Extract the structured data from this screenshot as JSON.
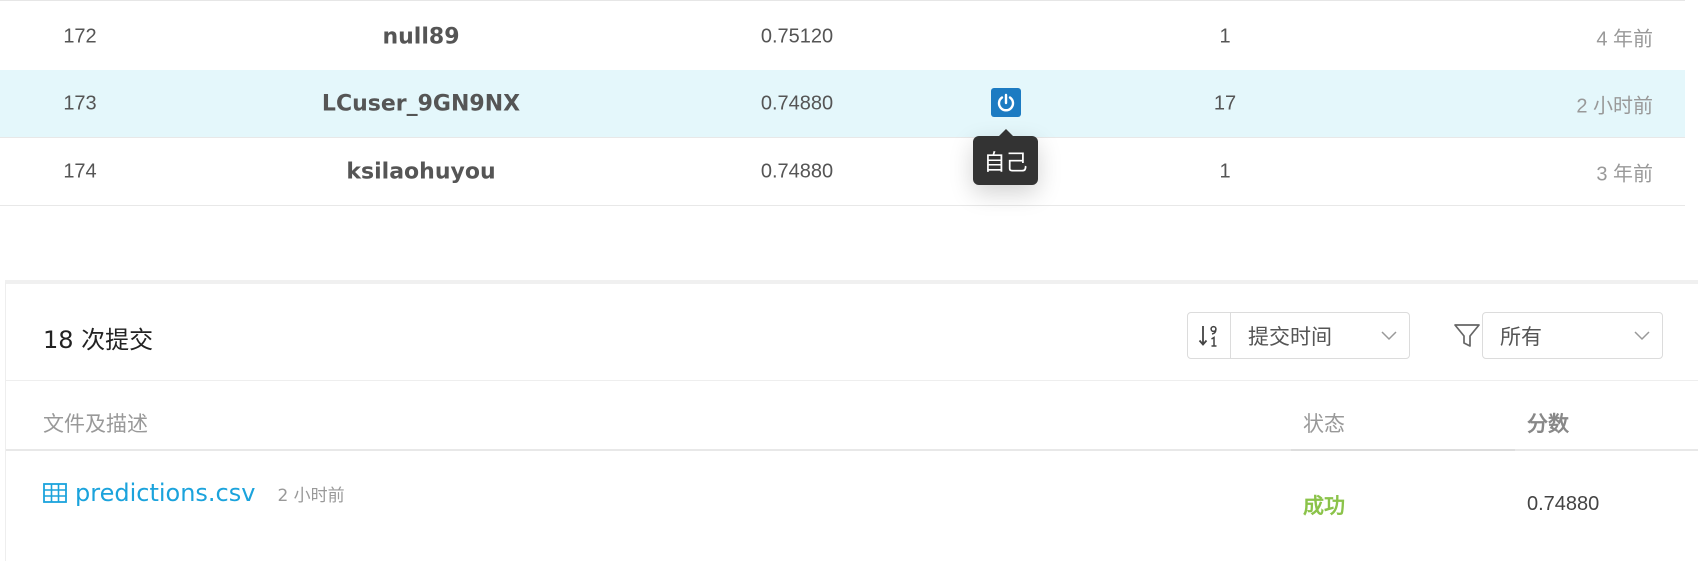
{
  "leaderboard": {
    "rows": [
      {
        "rank": "172",
        "name": "null89",
        "score": "0.75120",
        "entries": "1",
        "time": "4 年前",
        "is_self": false
      },
      {
        "rank": "173",
        "name": "LCuser_9GN9NX",
        "score": "0.74880",
        "entries": "17",
        "time": "2 小时前",
        "is_self": true
      },
      {
        "rank": "174",
        "name": "ksilaohuyou",
        "score": "0.74880",
        "entries": "1",
        "time": "3 年前",
        "is_self": false
      }
    ],
    "self_tooltip": "自己",
    "highlight_color": "#e4f7fb",
    "badge_color": "#1c7bc2",
    "badge_icon": "power-icon"
  },
  "submissions": {
    "count_label": "18 次提交",
    "sort": {
      "icon": "sort-numeric-icon",
      "selected": "提交时间"
    },
    "filter": {
      "icon": "filter-icon",
      "selected": "所有"
    },
    "headers": {
      "file": "文件及描述",
      "status": "状态",
      "score": "分数"
    },
    "items": [
      {
        "icon": "table-icon",
        "filename": "predictions.csv",
        "time": "2 小时前",
        "status": "成功",
        "score": "0.74880"
      }
    ],
    "link_color": "#1ba3dc",
    "success_color": "#8bc34a"
  }
}
